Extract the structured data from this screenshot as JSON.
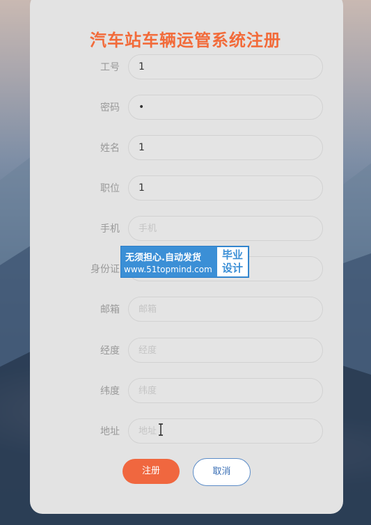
{
  "form": {
    "title": "汽车站车辆运管系统注册",
    "fields": [
      {
        "label": "工号",
        "value": "1",
        "placeholder": "",
        "type": "text"
      },
      {
        "label": "密码",
        "value": "1",
        "placeholder": "",
        "type": "password"
      },
      {
        "label": "姓名",
        "value": "1",
        "placeholder": "",
        "type": "text"
      },
      {
        "label": "职位",
        "value": "1",
        "placeholder": "",
        "type": "text"
      },
      {
        "label": "手机",
        "value": "",
        "placeholder": "手机",
        "type": "text"
      },
      {
        "label": "身份证",
        "value": "",
        "placeholder": "",
        "type": "text"
      },
      {
        "label": "邮箱",
        "value": "",
        "placeholder": "邮箱",
        "type": "text"
      },
      {
        "label": "经度",
        "value": "",
        "placeholder": "经度",
        "type": "text"
      },
      {
        "label": "纬度",
        "value": "",
        "placeholder": "纬度",
        "type": "text"
      },
      {
        "label": "地址",
        "value": "",
        "placeholder": "地址",
        "type": "text"
      }
    ],
    "register_label": "注册",
    "cancel_label": "取消"
  },
  "watermark": {
    "line1": "无须担心.自动发货",
    "line2": "www.51topmind.com",
    "box_top": "毕业",
    "box_bottom": "设计"
  },
  "colors": {
    "title": "#f26b3a",
    "register_button": "#f0673f",
    "cancel_text": "#3a6fb5",
    "watermark_bg": "#3b8fd6"
  }
}
